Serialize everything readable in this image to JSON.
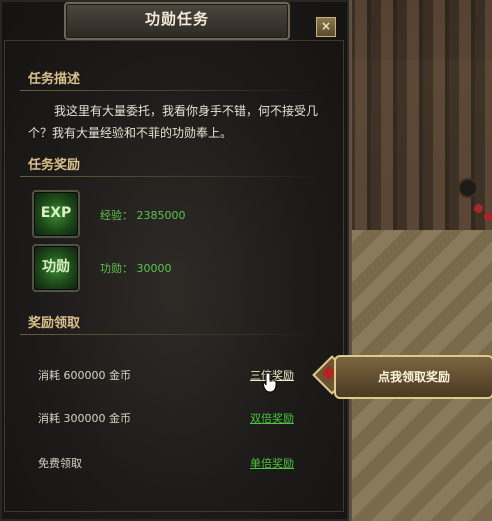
{
  "window": {
    "title": "功勋任务",
    "close_glyph": "×"
  },
  "description": {
    "heading": "任务描述",
    "text": "我这里有大量委托，我看你身手不错，何不接受几个？我有大量经验和不菲的功勋奉上。"
  },
  "rewards": {
    "heading": "任务奖励",
    "items": [
      {
        "icon_text": "EXP",
        "label": "经验：",
        "value": "2385000"
      },
      {
        "icon_text": "功勋",
        "label": "功勋：",
        "value": "30000"
      }
    ]
  },
  "claim": {
    "heading": "奖励领取",
    "options": [
      {
        "cost": "消耗 600000 金币",
        "link": "三倍奖励"
      },
      {
        "cost": "消耗 300000 金币",
        "link": "双倍奖励"
      },
      {
        "cost": "免费领取",
        "link": "单倍奖励"
      }
    ]
  },
  "tooltip": {
    "text": "点我领取奖励"
  },
  "colors": {
    "link_green": "#4bc43e",
    "heading_gold": "#d9c08b",
    "reward_green": "#5cc44e"
  }
}
